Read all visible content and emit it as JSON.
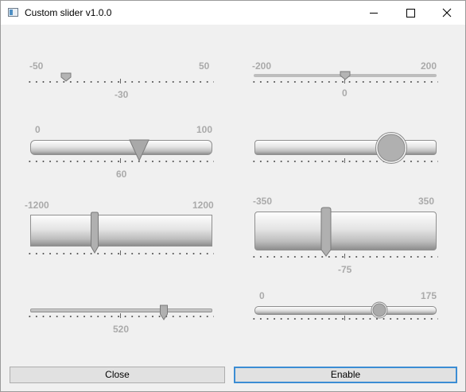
{
  "window": {
    "title": "Custom slider v1.0.0"
  },
  "sliders": [
    {
      "min": "-50",
      "max": "50",
      "value": "-30"
    },
    {
      "min": "-200",
      "max": "200",
      "value": "0"
    },
    {
      "min": "0",
      "max": "100",
      "value": "60"
    },
    {
      "min": "",
      "max": "",
      "value": ""
    },
    {
      "min": "-1200",
      "max": "1200",
      "value": ""
    },
    {
      "min": "-350",
      "max": "350",
      "value": "-75"
    },
    {
      "min": "",
      "max": "",
      "value": "520"
    },
    {
      "min": "0",
      "max": "175",
      "value": ""
    }
  ],
  "buttons": {
    "close_label": "Close",
    "enable_label": "Enable"
  },
  "colors": {
    "label_gray": "#aaaaaa",
    "focus_blue": "#3c8dd4",
    "client_bg": "#f0f0f0"
  }
}
